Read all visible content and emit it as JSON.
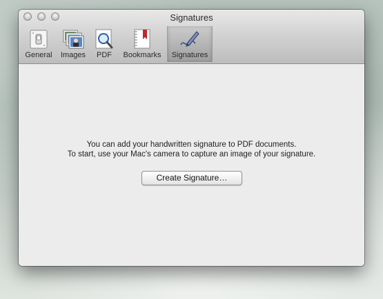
{
  "window": {
    "title": "Signatures"
  },
  "toolbar": {
    "items": [
      {
        "label": "General",
        "icon": "general-switch-icon"
      },
      {
        "label": "Images",
        "icon": "images-icon"
      },
      {
        "label": "PDF",
        "icon": "pdf-magnifier-icon"
      },
      {
        "label": "Bookmarks",
        "icon": "bookmarks-icon"
      },
      {
        "label": "Signatures",
        "icon": "signatures-pen-icon",
        "selected": true
      }
    ]
  },
  "main": {
    "message_line1": "You can add your handwritten signature to PDF documents.",
    "message_line2": "To start, use your Mac's camera to capture an image of your signature.",
    "create_button_label": "Create Signature…"
  }
}
